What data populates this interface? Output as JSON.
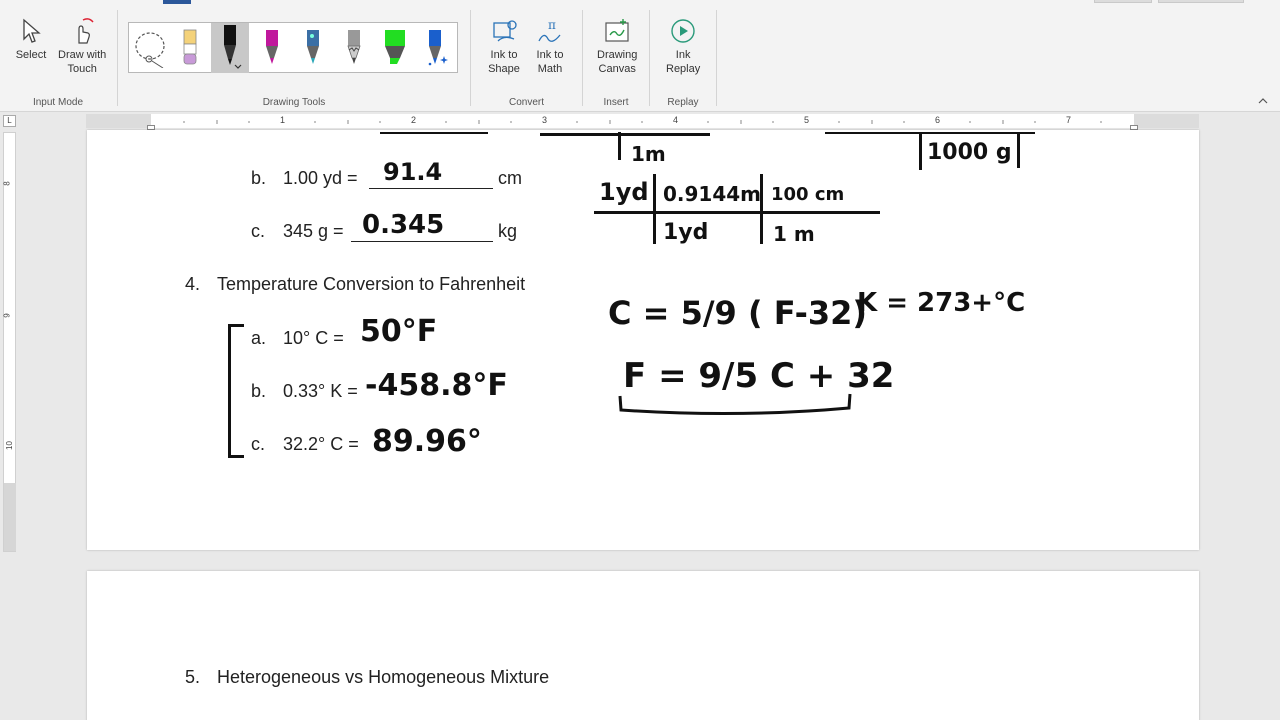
{
  "ribbon": {
    "input_mode": {
      "label": "Input Mode",
      "select": "Select",
      "draw_touch_line1": "Draw with",
      "draw_touch_line2": "Touch"
    },
    "drawing_tools": {
      "label": "Drawing Tools",
      "pens": [
        {
          "name": "lasso",
          "color": "#555555"
        },
        {
          "name": "pencil-beige",
          "color": "#f4d27a"
        },
        {
          "name": "pen-black",
          "color": "#111111"
        },
        {
          "name": "pen-magenta",
          "color": "#c0189c"
        },
        {
          "name": "pen-galaxy",
          "color": "#2aa7b8"
        },
        {
          "name": "pencil-gray",
          "color": "#777777"
        },
        {
          "name": "highlighter-green",
          "color": "#22dd22"
        },
        {
          "name": "pen-blue-sparkle",
          "color": "#1a5fcc"
        }
      ]
    },
    "convert": {
      "label": "Convert",
      "ink_shape_line1": "Ink to",
      "ink_shape_line2": "Shape",
      "ink_math_line1": "Ink to",
      "ink_math_line2": "Math"
    },
    "insert": {
      "label": "Insert",
      "canvas_line1": "Drawing",
      "canvas_line2": "Canvas"
    },
    "replay": {
      "label": "Replay",
      "ink_replay_line1": "Ink",
      "ink_replay_line2": "Replay"
    }
  },
  "ruler": {
    "numbers": [
      "1",
      "2",
      "3",
      "4",
      "5",
      "6",
      "7"
    ],
    "vertical_numbers": [
      "8",
      "9",
      "10"
    ],
    "corner": "L"
  },
  "document": {
    "item_b_length": {
      "label": "b.",
      "text": "1.00 yd =",
      "unit": "cm",
      "answer": "91.4"
    },
    "item_c_mass": {
      "label": "c.",
      "text": "345 g =",
      "unit": "kg",
      "answer": "0.345"
    },
    "q4": {
      "number": "4.",
      "text": "Temperature Conversion to Fahrenheit"
    },
    "q4a": {
      "label": "a.",
      "text": "10° C =",
      "answer": "50°F"
    },
    "q4b": {
      "label": "b.",
      "text": "0.33° K =",
      "answer": "-458.8°F"
    },
    "q4c": {
      "label": "c.",
      "text": "32.2° C =",
      "answer": "89.96°"
    },
    "q5": {
      "number": "5.",
      "text": "Heterogeneous vs Homogeneous Mixture"
    }
  },
  "ink_notes": {
    "top_left_unit": "1m",
    "top_right_unit": "1000 g",
    "factor_1yd": "1yd",
    "factor_09144m": "0.9144m",
    "factor_100cm": "100 cm",
    "denom_1yd": "1yd",
    "denom_1m": "1 m",
    "formula_c": "C = 5/9 ( F-32)",
    "formula_k": "K = 273+°C",
    "formula_f": "F = 9/5 C + 32"
  }
}
